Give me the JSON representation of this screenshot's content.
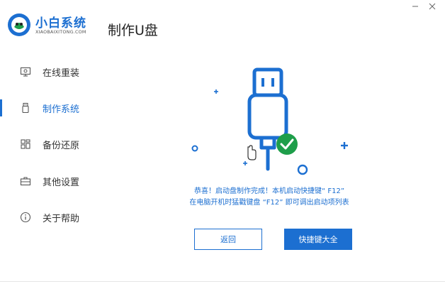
{
  "app": {
    "name": "小白系统",
    "subtitle": "XIAOBAIXITONG.COM"
  },
  "header": {
    "title": "制作U盘"
  },
  "window_controls": {
    "minimize_icon": "minimize-icon",
    "close_icon": "close-icon"
  },
  "sidebar": {
    "active_index": 1,
    "items": [
      {
        "label": "在线重装",
        "icon": "monitor-icon"
      },
      {
        "label": "制作系统",
        "icon": "usb-icon"
      },
      {
        "label": "备份还原",
        "icon": "grid-icon"
      },
      {
        "label": "其他设置",
        "icon": "briefcase-icon"
      },
      {
        "label": "关于帮助",
        "icon": "info-icon"
      }
    ]
  },
  "main": {
    "message_line1": "恭喜！启动盘制作完成！本机启动快捷键“ F12”",
    "message_line2": "在电脑开机时猛戳键盘 “F12” 即可调出启动项列表",
    "back_button": "返回",
    "hotkeys_button": "快捷键大全"
  },
  "colors": {
    "accent": "#1c6fd1",
    "success": "#1e9e4a"
  }
}
